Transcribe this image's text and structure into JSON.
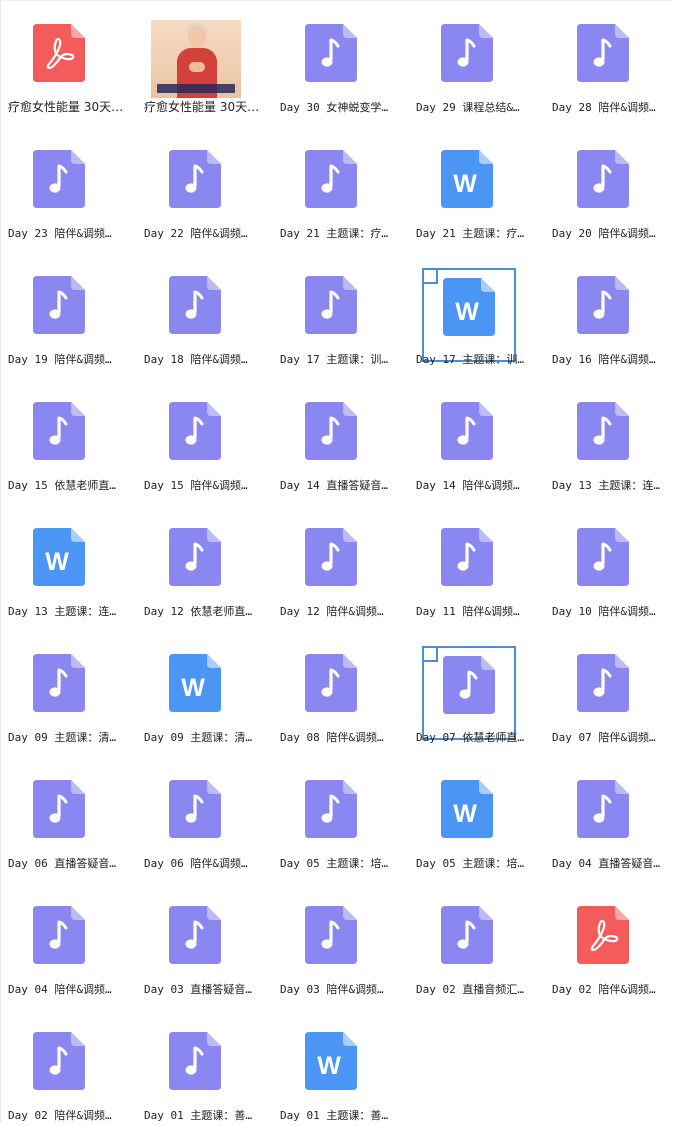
{
  "colors": {
    "audio": "#8b87f0",
    "audio_fold": "#bdbaf8",
    "word": "#4b96f4",
    "word_fold": "#a9cdfb",
    "pdf": "#f45b5b",
    "pdf_fold": "#f9a7a7",
    "selection": "#4a8fd4"
  },
  "files": [
    {
      "name": "疗愈女性能量 30天…",
      "type": "pdf",
      "icon": "pdf-icon"
    },
    {
      "name": "疗愈女性能量 30天…",
      "type": "video",
      "icon": "video-thumbnail"
    },
    {
      "name": "Day 30 女神蜕变学…",
      "type": "audio",
      "icon": "audio-file-icon"
    },
    {
      "name": "Day 29 课程总结&…",
      "type": "audio",
      "icon": "audio-file-icon"
    },
    {
      "name": "Day 28 陪伴&调频…",
      "type": "audio",
      "icon": "audio-file-icon"
    },
    {
      "name": "Day 23 陪伴&调频…",
      "type": "audio",
      "icon": "audio-file-icon"
    },
    {
      "name": "Day 22 陪伴&调频…",
      "type": "audio",
      "icon": "audio-file-icon"
    },
    {
      "name": "Day 21 主题课：疗…",
      "type": "audio",
      "icon": "audio-file-icon"
    },
    {
      "name": "Day 21 主题课：疗…",
      "type": "word",
      "icon": "word-doc-icon"
    },
    {
      "name": "Day 20 陪伴&调频…",
      "type": "audio",
      "icon": "audio-file-icon"
    },
    {
      "name": "Day 19 陪伴&调频…",
      "type": "audio",
      "icon": "audio-file-icon"
    },
    {
      "name": "Day 18 陪伴&调频…",
      "type": "audio",
      "icon": "audio-file-icon"
    },
    {
      "name": "Day 17 主题课：训…",
      "type": "audio",
      "icon": "audio-file-icon"
    },
    {
      "name": "Day 17 主题课：训…",
      "type": "word",
      "icon": "word-doc-icon",
      "selected": true
    },
    {
      "name": "Day 16 陪伴&调频…",
      "type": "audio",
      "icon": "audio-file-icon"
    },
    {
      "name": "Day 15 依慧老师直…",
      "type": "audio",
      "icon": "audio-file-icon"
    },
    {
      "name": "Day 15 陪伴&调频…",
      "type": "audio",
      "icon": "audio-file-icon"
    },
    {
      "name": "Day 14 直播答疑音…",
      "type": "audio",
      "icon": "audio-file-icon"
    },
    {
      "name": "Day 14 陪伴&调频…",
      "type": "audio",
      "icon": "audio-file-icon"
    },
    {
      "name": "Day 13 主题课：连…",
      "type": "audio",
      "icon": "audio-file-icon"
    },
    {
      "name": "Day 13 主题课：连…",
      "type": "word",
      "icon": "word-doc-icon"
    },
    {
      "name": "Day 12 依慧老师直…",
      "type": "audio",
      "icon": "audio-file-icon"
    },
    {
      "name": "Day 12 陪伴&调频…",
      "type": "audio",
      "icon": "audio-file-icon"
    },
    {
      "name": "Day 11 陪伴&调频…",
      "type": "audio",
      "icon": "audio-file-icon"
    },
    {
      "name": "Day 10 陪伴&调频…",
      "type": "audio",
      "icon": "audio-file-icon"
    },
    {
      "name": "Day 09 主题课：清…",
      "type": "audio",
      "icon": "audio-file-icon"
    },
    {
      "name": "Day 09 主题课：清…",
      "type": "word",
      "icon": "word-doc-icon"
    },
    {
      "name": "Day 08 陪伴&调频…",
      "type": "audio",
      "icon": "audio-file-icon"
    },
    {
      "name": "Day 07 依慧老师直…",
      "type": "audio",
      "icon": "audio-file-icon",
      "selected": true
    },
    {
      "name": "Day 07 陪伴&调频…",
      "type": "audio",
      "icon": "audio-file-icon"
    },
    {
      "name": "Day 06 直播答疑音…",
      "type": "audio",
      "icon": "audio-file-icon"
    },
    {
      "name": "Day 06 陪伴&调频…",
      "type": "audio",
      "icon": "audio-file-icon"
    },
    {
      "name": "Day 05 主题课：培…",
      "type": "audio",
      "icon": "audio-file-icon"
    },
    {
      "name": "Day 05 主题课：培…",
      "type": "word",
      "icon": "word-doc-icon"
    },
    {
      "name": "Day 04 直播答疑音…",
      "type": "audio",
      "icon": "audio-file-icon"
    },
    {
      "name": "Day 04 陪伴&调频…",
      "type": "audio",
      "icon": "audio-file-icon"
    },
    {
      "name": "Day 03 直播答疑音…",
      "type": "audio",
      "icon": "audio-file-icon"
    },
    {
      "name": "Day 03 陪伴&调频…",
      "type": "audio",
      "icon": "audio-file-icon"
    },
    {
      "name": "Day 02 直播音频汇…",
      "type": "audio",
      "icon": "audio-file-icon"
    },
    {
      "name": "Day 02 陪伴&调频…",
      "type": "pdf",
      "icon": "pdf-icon"
    },
    {
      "name": "Day 02 陪伴&调频…",
      "type": "audio",
      "icon": "audio-file-icon"
    },
    {
      "name": "Day 01 主题课：善…",
      "type": "audio",
      "icon": "audio-file-icon"
    },
    {
      "name": "Day 01 主题课：善…",
      "type": "word",
      "icon": "word-doc-icon"
    }
  ]
}
